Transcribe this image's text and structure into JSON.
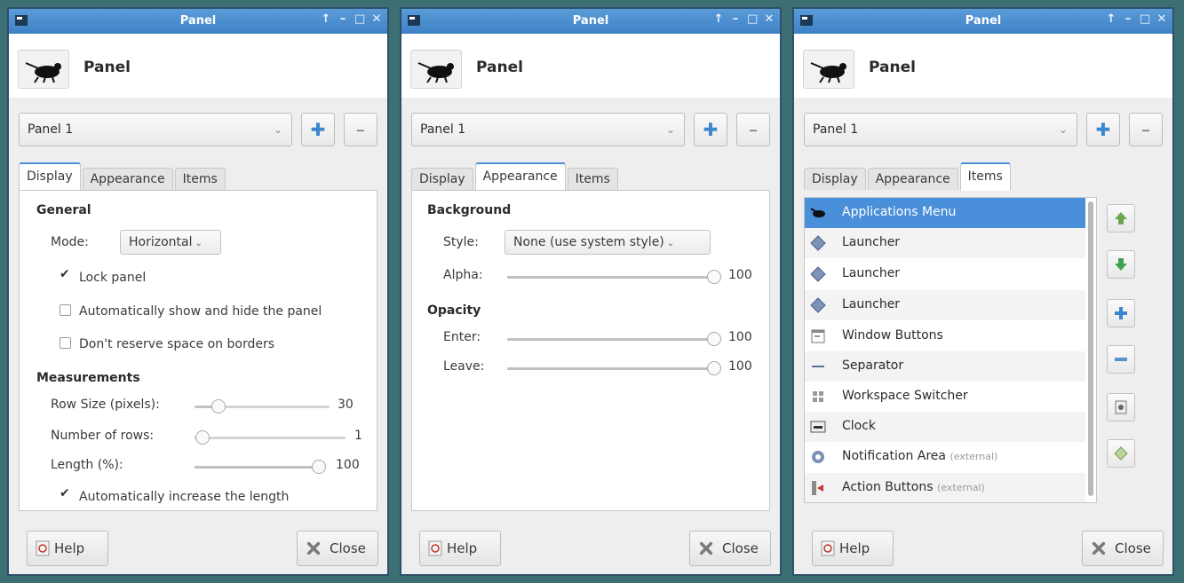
{
  "windows": [
    {
      "title": "Panel",
      "header_title": "Panel",
      "panel_select": "Panel 1",
      "tabs": [
        "Display",
        "Appearance",
        "Items"
      ],
      "active_tab": "Display",
      "display": {
        "general_heading": "General",
        "mode_label": "Mode:",
        "mode_value": "Horizontal",
        "lock_panel": "Lock panel",
        "lock_panel_checked": true,
        "autohide": "Automatically show and hide the panel",
        "autohide_checked": false,
        "dont_reserve": "Don't reserve space on borders",
        "dont_reserve_checked": false,
        "measurements_heading": "Measurements",
        "row_size_label": "Row Size (pixels):",
        "row_size_value": "30",
        "rows_label": "Number of rows:",
        "rows_value": "1",
        "length_label": "Length (%):",
        "length_value": "100",
        "auto_length": "Automatically increase the length",
        "auto_length_checked": true
      },
      "help_label": "Help",
      "close_label": "Close"
    },
    {
      "title": "Panel",
      "header_title": "Panel",
      "panel_select": "Panel 1",
      "tabs": [
        "Display",
        "Appearance",
        "Items"
      ],
      "active_tab": "Appearance",
      "appearance": {
        "background_heading": "Background",
        "style_label": "Style:",
        "style_value": "None (use system style)",
        "alpha_label": "Alpha:",
        "alpha_value": "100",
        "opacity_heading": "Opacity",
        "enter_label": "Enter:",
        "enter_value": "100",
        "leave_label": "Leave:",
        "leave_value": "100"
      },
      "help_label": "Help",
      "close_label": "Close"
    },
    {
      "title": "Panel",
      "header_title": "Panel",
      "panel_select": "Panel 1",
      "tabs": [
        "Display",
        "Appearance",
        "Items"
      ],
      "active_tab": "Items",
      "items": [
        {
          "label": "Applications Menu",
          "ext": "",
          "icon": "mouse-icon",
          "selected": true
        },
        {
          "label": "Launcher",
          "ext": "",
          "icon": "launcher-icon"
        },
        {
          "label": "Launcher",
          "ext": "",
          "icon": "launcher-icon"
        },
        {
          "label": "Launcher",
          "ext": "",
          "icon": "launcher-icon"
        },
        {
          "label": "Window Buttons",
          "ext": "",
          "icon": "window-buttons-icon"
        },
        {
          "label": "Separator",
          "ext": "",
          "icon": "separator-icon"
        },
        {
          "label": "Workspace Switcher",
          "ext": "",
          "icon": "workspace-switcher-icon"
        },
        {
          "label": "Clock",
          "ext": "",
          "icon": "clock-icon"
        },
        {
          "label": "Notification Area",
          "ext": "(external)",
          "icon": "gear-icon"
        },
        {
          "label": "Action Buttons",
          "ext": "(external)",
          "icon": "action-buttons-icon"
        }
      ],
      "help_label": "Help",
      "close_label": "Close"
    }
  ],
  "titlebar_buttons": [
    "↑",
    "–",
    "□",
    "✕"
  ],
  "colors": {
    "titlebar": "#4a8fd0",
    "selection": "#4a8fd9",
    "accent_add": "#3a86cf",
    "desktop": "#3c6f74"
  }
}
